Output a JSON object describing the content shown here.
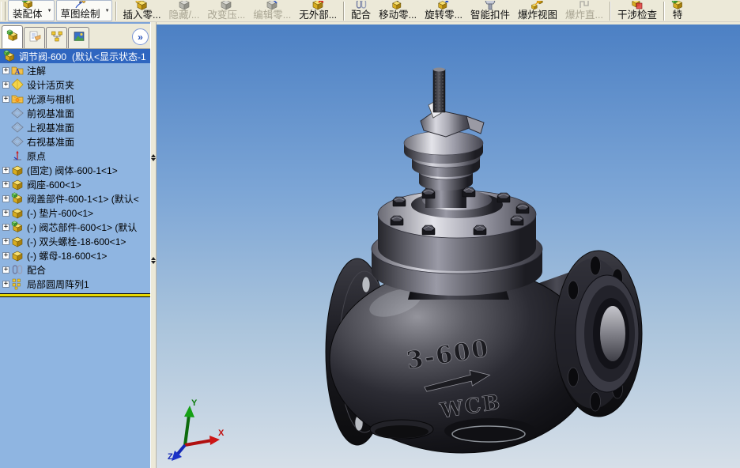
{
  "colors": {
    "accent_selection": "#2f66c0",
    "panel_bg": "#8fb5e1",
    "toolbar_bg": "#ece9d8",
    "viewport_top": "#4c80c4",
    "viewport_bottom": "#d6dfe8",
    "rollback": "#e8d800"
  },
  "toolbar": {
    "dropdown_symbol": "▼",
    "items": [
      {
        "type": "btn",
        "name": "assembly",
        "icon": "assembly",
        "label": "装配体",
        "raised": true,
        "dropdown": true
      },
      {
        "type": "btn",
        "name": "sketch",
        "icon": "sketch",
        "label": "草图绘制",
        "raised": true,
        "dropdown": true
      },
      {
        "type": "sep"
      },
      {
        "type": "btn",
        "name": "insert-component",
        "icon": "insert-component",
        "label": "插入零..."
      },
      {
        "type": "btn",
        "name": "hide-component",
        "icon": "hide-component",
        "label": "隐藏/...",
        "disabled": true
      },
      {
        "type": "btn",
        "name": "change-suppression",
        "icon": "change-suppression",
        "label": "改变压...",
        "disabled": true
      },
      {
        "type": "btn",
        "name": "edit-component",
        "icon": "edit-component",
        "label": "编辑零...",
        "disabled": true
      },
      {
        "type": "btn",
        "name": "no-external-ref",
        "icon": "no-external-ref",
        "label": "无外部..."
      },
      {
        "type": "sep"
      },
      {
        "type": "btn",
        "name": "mate",
        "icon": "mate",
        "label": "配合"
      },
      {
        "type": "btn",
        "name": "move-component",
        "icon": "move-component",
        "label": "移动零..."
      },
      {
        "type": "btn",
        "name": "rotate-component",
        "icon": "rotate-component",
        "label": "旋转零..."
      },
      {
        "type": "btn",
        "name": "smart-fasteners",
        "icon": "smart-fasteners",
        "label": "智能扣件"
      },
      {
        "type": "btn",
        "name": "exploded-view",
        "icon": "exploded-view",
        "label": "爆炸视图"
      },
      {
        "type": "btn",
        "name": "explode-line",
        "icon": "explode-line",
        "label": "爆炸直...",
        "disabled": true
      },
      {
        "type": "sep"
      },
      {
        "type": "btn",
        "name": "interference-check",
        "icon": "interference-check",
        "label": "干涉检查"
      },
      {
        "type": "sep"
      },
      {
        "type": "btn",
        "name": "features",
        "icon": "features",
        "label": "特"
      }
    ]
  },
  "panel": {
    "chevron": "»",
    "expand_symbol": "+",
    "tabs": [
      {
        "name": "featuremanager",
        "icon": "tab-features"
      },
      {
        "name": "propertymanager",
        "icon": "tab-properties"
      },
      {
        "name": "configurationmanager",
        "icon": "tab-configurations"
      },
      {
        "name": "displaymanager",
        "icon": "tab-display"
      }
    ],
    "tree": {
      "root": {
        "name": "assembly-root",
        "icon": "assembly",
        "label": "调节阀-600",
        "suffix": "(默认<显示状态-1"
      },
      "items": [
        {
          "name": "annotations",
          "icon": "annotations",
          "label": "注解",
          "expand": true
        },
        {
          "name": "design-binder",
          "icon": "design-binder",
          "label": "设计活页夹",
          "expand": true
        },
        {
          "name": "lights-cameras",
          "icon": "lights-cameras",
          "label": "光源与相机",
          "expand": true
        },
        {
          "name": "front-plane",
          "icon": "plane",
          "label": "前视基准面",
          "expand": false
        },
        {
          "name": "top-plane",
          "icon": "plane",
          "label": "上视基准面",
          "expand": false
        },
        {
          "name": "right-plane",
          "icon": "plane",
          "label": "右视基准面",
          "expand": false
        },
        {
          "name": "origin",
          "icon": "origin",
          "label": "原点",
          "expand": false
        },
        {
          "name": "valve-body",
          "icon": "part",
          "label": "(固定) 阀体-600-1<1>",
          "expand": true
        },
        {
          "name": "valve-seat",
          "icon": "part",
          "label": "阀座-600<1>",
          "expand": true
        },
        {
          "name": "bonnet-assembly",
          "icon": "subassembly",
          "label": "阀盖部件-600-1<1> (默认<",
          "expand": true
        },
        {
          "name": "gasket",
          "icon": "part",
          "label": "(-) 垫片-600<1>",
          "expand": true
        },
        {
          "name": "valve-core-assembly",
          "icon": "subassembly",
          "label": "(-) 阀芯部件-600<1> (默认",
          "expand": true
        },
        {
          "name": "stud-bolt",
          "icon": "part",
          "label": "(-) 双头螺栓-18-600<1>",
          "expand": true
        },
        {
          "name": "nut",
          "icon": "part",
          "label": "(-) 螺母-18-600<1>",
          "expand": true
        },
        {
          "name": "mates",
          "icon": "mates",
          "label": "配合",
          "expand": true
        },
        {
          "name": "circular-pattern",
          "icon": "pattern",
          "label": "局部圆周阵列1",
          "expand": true
        }
      ]
    }
  },
  "viewport": {
    "markings": {
      "size": "3-600",
      "material": "WCB"
    },
    "triad": {
      "x": "X",
      "y": "Y",
      "z": "Z"
    }
  }
}
